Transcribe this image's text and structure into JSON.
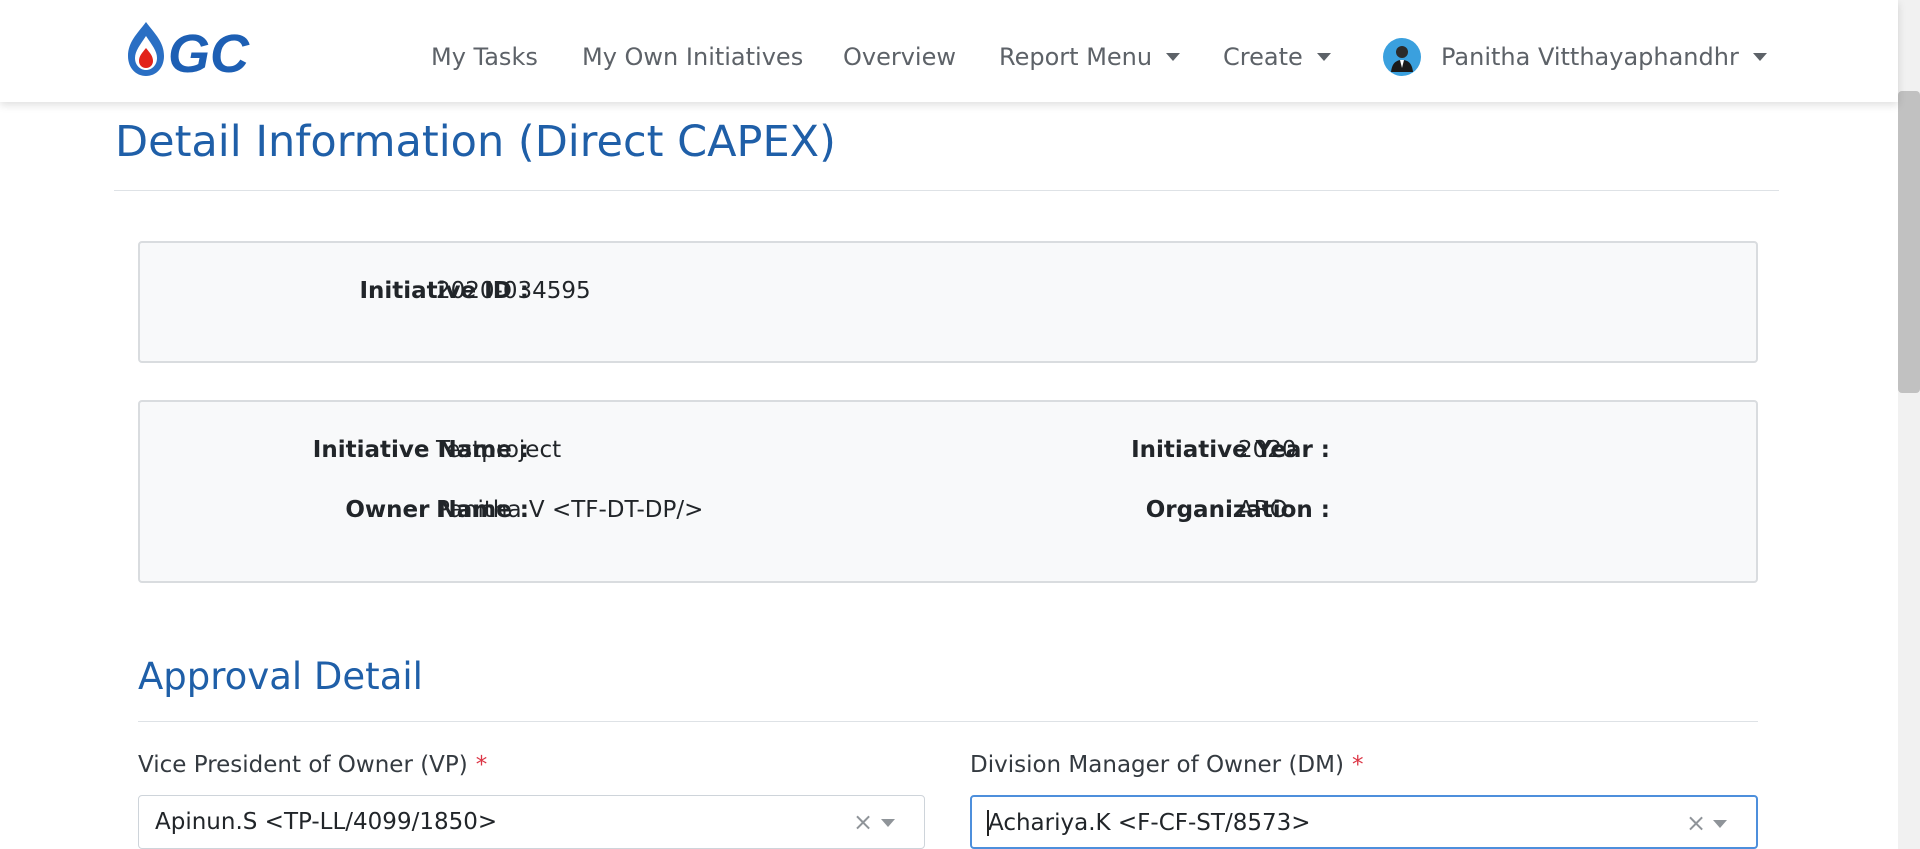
{
  "brand": {
    "name": "GC",
    "accent_color": "#1f5fa8"
  },
  "nav": {
    "items": [
      {
        "label": "My Tasks"
      },
      {
        "label": "My Own Initiatives"
      },
      {
        "label": "Overview"
      },
      {
        "label": "Report Menu",
        "has_dropdown": true
      },
      {
        "label": "Create",
        "has_dropdown": true
      }
    ],
    "user": {
      "name": "Panitha Vitthayaphandhr",
      "avatar_icon": "user-avatar-icon"
    }
  },
  "page": {
    "title": "Detail Information (Direct CAPEX)"
  },
  "initiative": {
    "id_label": "Initiative ID :",
    "id_value": "2020-034595",
    "name_label": "Initiative Name :",
    "name_value": "Testproject",
    "year_label": "Initiative Year :",
    "year_value": "2020",
    "owner_label": "Owner Name :",
    "owner_value": "Panitha.V <TF-DT-DP/>",
    "org_label": "Organization :",
    "org_value": "ARO"
  },
  "approval": {
    "title": "Approval Detail",
    "vp": {
      "label": "Vice President of Owner (VP)",
      "required_mark": "*",
      "value": "Apinun.S <TP-LL/4099/1850>",
      "clear_icon": "×"
    },
    "dm": {
      "label": "Division Manager of Owner (DM)",
      "required_mark": "*",
      "value": "Achariya.K <F-CF-ST/8573>",
      "clear_icon": "×"
    }
  }
}
